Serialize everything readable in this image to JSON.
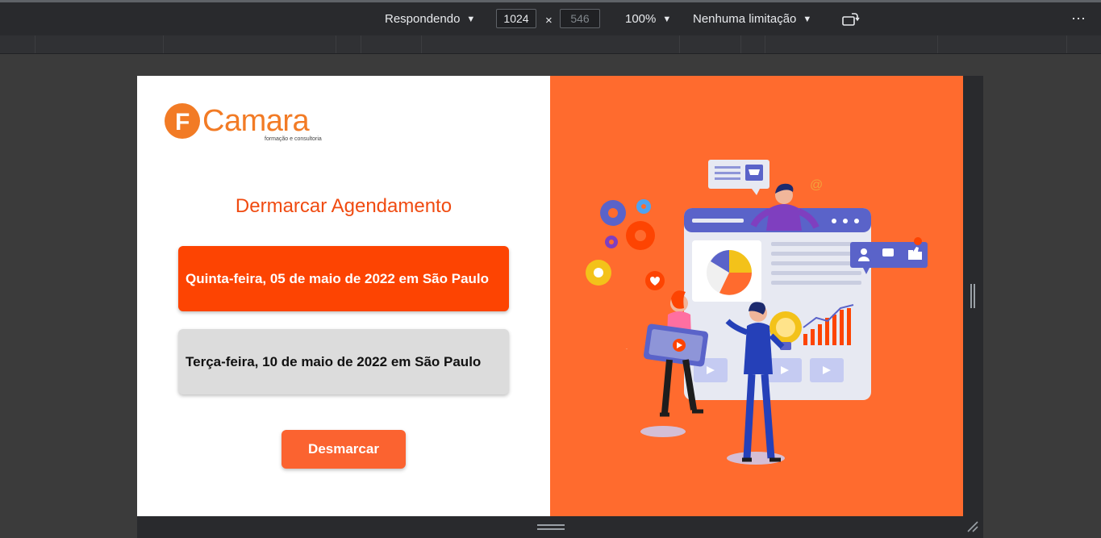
{
  "toolbar": {
    "device_mode": "Respondendo",
    "width": "1024",
    "height": "546",
    "times": "×",
    "zoom": "100%",
    "throttling": "Nenhuma limitação",
    "rotate_icon": "rotate-icon",
    "more_icon": "more-options-icon"
  },
  "page": {
    "logo": {
      "word": "Camara",
      "letter": "F",
      "tagline": "formação e consultoria",
      "color": "#f27b25"
    },
    "title": "Dermarcar Agendamento",
    "dates": [
      {
        "label": "Quinta-feira, 05 de maio de 2022 em São Paulo",
        "selected": true
      },
      {
        "label": "Terça-feira, 10 de maio de 2022 em São Paulo",
        "selected": false
      }
    ],
    "cancel_button": "Desmarcar",
    "accent": "#fd4402",
    "panel_color": "#ff6b2e",
    "illustration": "marketing-team-dashboard-illustration"
  }
}
